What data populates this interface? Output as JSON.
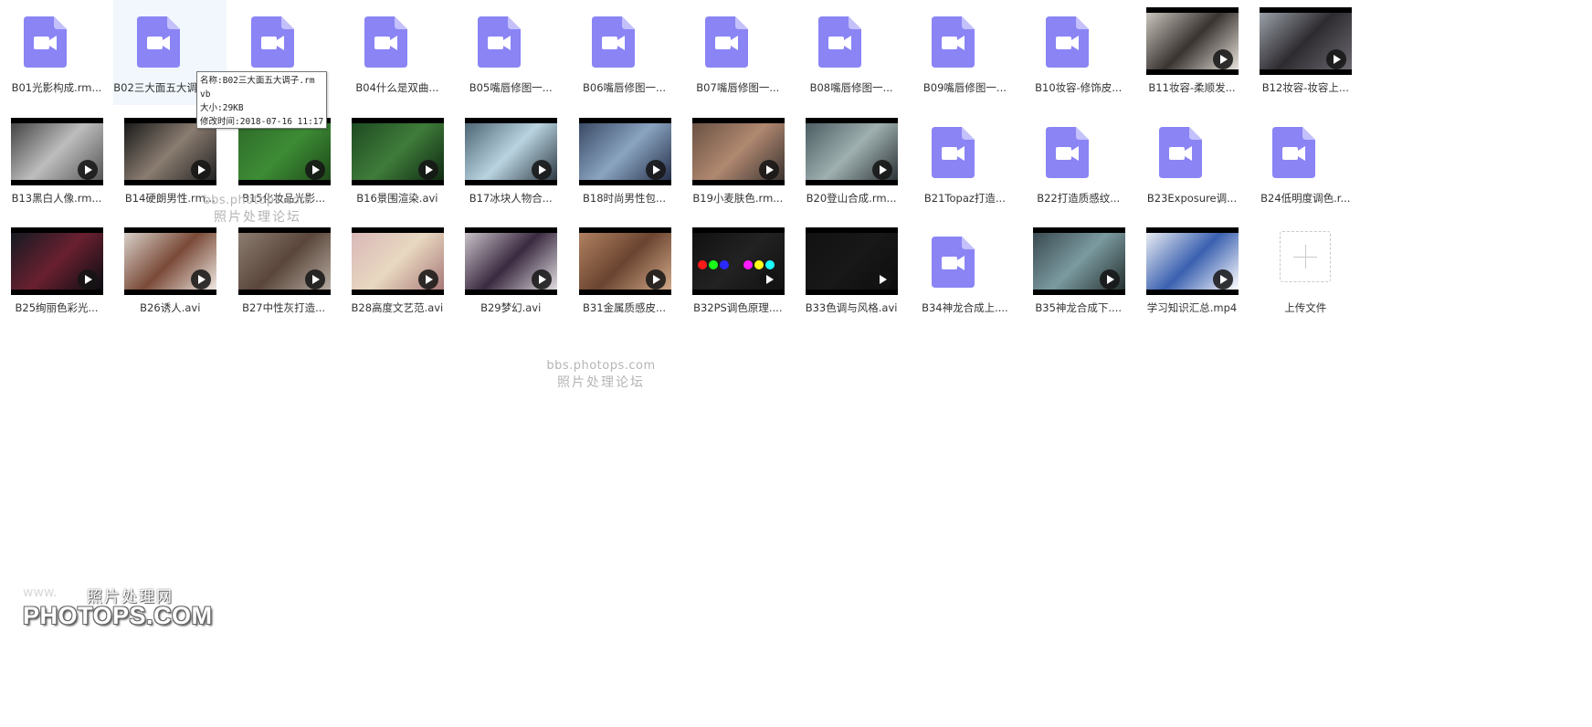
{
  "colors": {
    "video_icon": "#8a84f5",
    "video_icon_fold": "#c4c0fb",
    "hover_bg": "#f1f7fd",
    "label_text": "#333333",
    "watermark": "#b5b5b5"
  },
  "files": [
    {
      "name": "B01光影构成.rm...",
      "kind": "video-icon",
      "row": 0,
      "col": 0
    },
    {
      "name": "B02三大面五大调子.rmvb",
      "kind": "video-icon",
      "row": 0,
      "col": 1,
      "hovered": true
    },
    {
      "name": "",
      "kind": "video-icon",
      "row": 0,
      "col": 2
    },
    {
      "name": "B04什么是双曲...",
      "kind": "video-icon",
      "row": 0,
      "col": 3
    },
    {
      "name": "B05嘴唇修图一...",
      "kind": "video-icon",
      "row": 0,
      "col": 4
    },
    {
      "name": "B06嘴唇修图一...",
      "kind": "video-icon",
      "row": 0,
      "col": 5
    },
    {
      "name": "B07嘴唇修图一...",
      "kind": "video-icon",
      "row": 0,
      "col": 6
    },
    {
      "name": "B08嘴唇修图一...",
      "kind": "video-icon",
      "row": 0,
      "col": 7
    },
    {
      "name": "B09嘴唇修图一...",
      "kind": "video-icon",
      "row": 0,
      "col": 8
    },
    {
      "name": "B10妆容-修饰皮...",
      "kind": "video-icon",
      "row": 0,
      "col": 9
    },
    {
      "name": "B11妆容-柔顺发...",
      "kind": "thumbnail",
      "row": 0,
      "col": 10,
      "tone": [
        "#c9c3bd",
        "#3a3431",
        "#e8e2dc"
      ]
    },
    {
      "name": "B12妆容-妆容上...",
      "kind": "thumbnail",
      "row": 0,
      "col": 11,
      "tone": [
        "#9aa0a8",
        "#2e2b30",
        "#6b6870"
      ]
    },
    {
      "name": "B13黑白人像.rm...",
      "kind": "thumbnail",
      "row": 1,
      "col": 0,
      "tone": [
        "#444",
        "#bdbdbd",
        "#555"
      ]
    },
    {
      "name": "B14硬朗男性.rm...",
      "kind": "thumbnail",
      "row": 1,
      "col": 1,
      "tone": [
        "#1a1a1a",
        "#8a7c70",
        "#222"
      ]
    },
    {
      "name": "B15化妆品光影...",
      "kind": "thumbnail",
      "row": 1,
      "col": 2,
      "tone": [
        "#2f6b2a",
        "#3d8c35",
        "#1f4a1a"
      ]
    },
    {
      "name": "B16景围渲染.avi",
      "kind": "thumbnail",
      "row": 1,
      "col": 3,
      "tone": [
        "#1e4a22",
        "#3f7c3a",
        "#0f2a12"
      ]
    },
    {
      "name": "B17冰块人物合...",
      "kind": "thumbnail",
      "row": 1,
      "col": 4,
      "tone": [
        "#4d6675",
        "#b9d4e0",
        "#2d3a45"
      ]
    },
    {
      "name": "B18时尚男性包...",
      "kind": "thumbnail",
      "row": 1,
      "col": 5,
      "tone": [
        "#3a4a66",
        "#8aa4c0",
        "#26304a"
      ]
    },
    {
      "name": "B19小麦肤色.rm...",
      "kind": "thumbnail",
      "row": 1,
      "col": 6,
      "tone": [
        "#6b5243",
        "#b08870",
        "#3a3330"
      ]
    },
    {
      "name": "B20登山合成.rm...",
      "kind": "thumbnail",
      "row": 1,
      "col": 7,
      "tone": [
        "#4c5d63",
        "#9fb0b0",
        "#2c3438"
      ]
    },
    {
      "name": "B21Topaz打造...",
      "kind": "video-icon",
      "row": 1,
      "col": 8
    },
    {
      "name": "B22打造质感纹...",
      "kind": "video-icon",
      "row": 1,
      "col": 9
    },
    {
      "name": "B23Exposure调...",
      "kind": "video-icon",
      "row": 1,
      "col": 10
    },
    {
      "name": "B24低明度调色.r...",
      "kind": "video-icon",
      "row": 1,
      "col": 11
    },
    {
      "name": "B25绚丽色彩光...",
      "kind": "thumbnail",
      "row": 2,
      "col": 0,
      "tone": [
        "#141a22",
        "#6a2030",
        "#0a0d12"
      ]
    },
    {
      "name": "B26诱人.avi",
      "kind": "thumbnail",
      "row": 2,
      "col": 1,
      "tone": [
        "#d8cfc8",
        "#7a4a38",
        "#efe8e2"
      ]
    },
    {
      "name": "B27中性灰打造...",
      "kind": "thumbnail",
      "row": 2,
      "col": 2,
      "tone": [
        "#8c7c70",
        "#5a463a",
        "#b5aaa0"
      ]
    },
    {
      "name": "B28高度文艺范.avi",
      "kind": "thumbnail",
      "row": 2,
      "col": 3,
      "tone": [
        "#d9b8b8",
        "#e8d8c0",
        "#a87878"
      ]
    },
    {
      "name": "B29梦幻.avi",
      "kind": "thumbnail",
      "row": 2,
      "col": 4,
      "tone": [
        "#c8c0c8",
        "#3a2a40",
        "#e0dce0"
      ]
    },
    {
      "name": "B31金属质感皮...",
      "kind": "thumbnail",
      "row": 2,
      "col": 5,
      "tone": [
        "#b08060",
        "#6a4430",
        "#d0a888"
      ]
    },
    {
      "name": "B32PS调色原理....",
      "kind": "thumbnail",
      "row": 2,
      "col": 6,
      "tone": [
        "#111",
        "#222",
        "#111"
      ],
      "dots": [
        "#ff1a1a",
        "#1aff1a",
        "#2a2aff",
        "#ff1aff",
        "#ffff1a",
        "#1affff"
      ]
    },
    {
      "name": "B33色调与风格.avi",
      "kind": "thumbnail",
      "row": 2,
      "col": 7,
      "tone": [
        "#111",
        "#181818",
        "#0d0d0d"
      ]
    },
    {
      "name": "B34神龙合成上....",
      "kind": "video-icon",
      "row": 2,
      "col": 8
    },
    {
      "name": "B35神龙合成下....",
      "kind": "thumbnail",
      "row": 2,
      "col": 9,
      "tone": [
        "#3a4a50",
        "#7a9aa0",
        "#25302f"
      ]
    },
    {
      "name": "学习知识汇总.mp4",
      "kind": "thumbnail",
      "row": 2,
      "col": 10,
      "tone": [
        "#e8ecf2",
        "#3a60b0",
        "#ffffff"
      ]
    },
    {
      "name": "上传文件",
      "kind": "upload",
      "row": 2,
      "col": 11
    }
  ],
  "tooltip": {
    "line1": "名称:B02三大面五大调子.rm",
    "line2": "vb",
    "line3": "大小:29KB",
    "line4": "修改时间:2018-07-16 11:17"
  },
  "watermarks": {
    "url": "bbs.photops.com",
    "forum": "照片处理论坛",
    "logo_small": "www.",
    "logo_cn": "照片处理网",
    "logo_big": "PHOTOPS.COM"
  }
}
